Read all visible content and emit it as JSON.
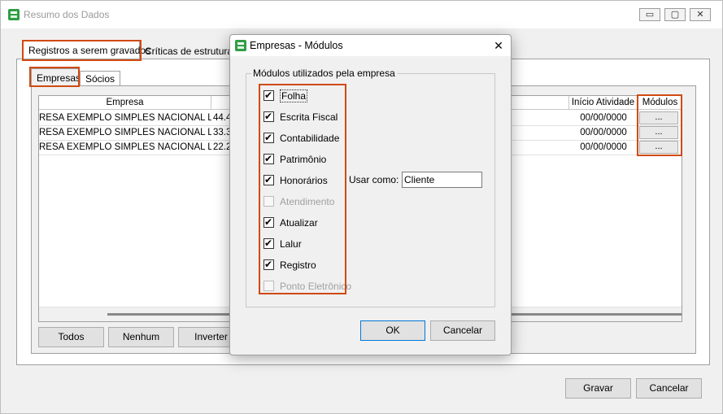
{
  "main_window": {
    "title": "Resumo dos Dados",
    "tabs": [
      "Registros a serem gravados",
      "Críticas de estruturas"
    ],
    "subtabs": [
      "Empresas",
      "Sócios"
    ],
    "grid": {
      "col_empresa": "Empresa",
      "col_inicio": "Início Atividade",
      "col_modulos": "Módulos",
      "rows": [
        {
          "empresa": "RESA EXEMPLO SIMPLES NACIONAL LTDA",
          "valor": "44.4",
          "inicio": "00/00/0000",
          "modulos": "..."
        },
        {
          "empresa": "RESA EXEMPLO SIMPLES NACIONAL LTDA",
          "valor": "33.3",
          "inicio": "00/00/0000",
          "modulos": "..."
        },
        {
          "empresa": "RESA EXEMPLO SIMPLES NACIONAL LTDA",
          "valor": "22.2",
          "inicio": "00/00/0000",
          "modulos": "..."
        }
      ]
    },
    "buttons": {
      "todos": "Todos",
      "nenhum": "Nenhum",
      "inverter": "Inverter",
      "gravar": "Gravar",
      "cancelar": "Cancelar"
    }
  },
  "dialog": {
    "title": "Empresas - Módulos",
    "group_label": "Módulos utilizados pela empresa",
    "modules": [
      {
        "label": "Folha",
        "checked": true,
        "enabled": true
      },
      {
        "label": "Escrita Fiscal",
        "checked": true,
        "enabled": true
      },
      {
        "label": "Contabilidade",
        "checked": true,
        "enabled": true
      },
      {
        "label": "Patrimônio",
        "checked": true,
        "enabled": true
      },
      {
        "label": "Honorários",
        "checked": true,
        "enabled": true
      },
      {
        "label": "Atendimento",
        "checked": false,
        "enabled": false
      },
      {
        "label": "Atualizar",
        "checked": true,
        "enabled": true
      },
      {
        "label": "Lalur",
        "checked": true,
        "enabled": true
      },
      {
        "label": "Registro",
        "checked": true,
        "enabled": true
      },
      {
        "label": "Ponto Eletrônico",
        "checked": false,
        "enabled": false
      }
    ],
    "usar_como_label": "Usar como:",
    "usar_como_value": "Cliente",
    "ok_label": "OK",
    "cancel_label": "Cancelar",
    "close_glyph": "✕"
  },
  "colors": {
    "highlight": "#d04a12",
    "default_button": "#0078d7"
  }
}
